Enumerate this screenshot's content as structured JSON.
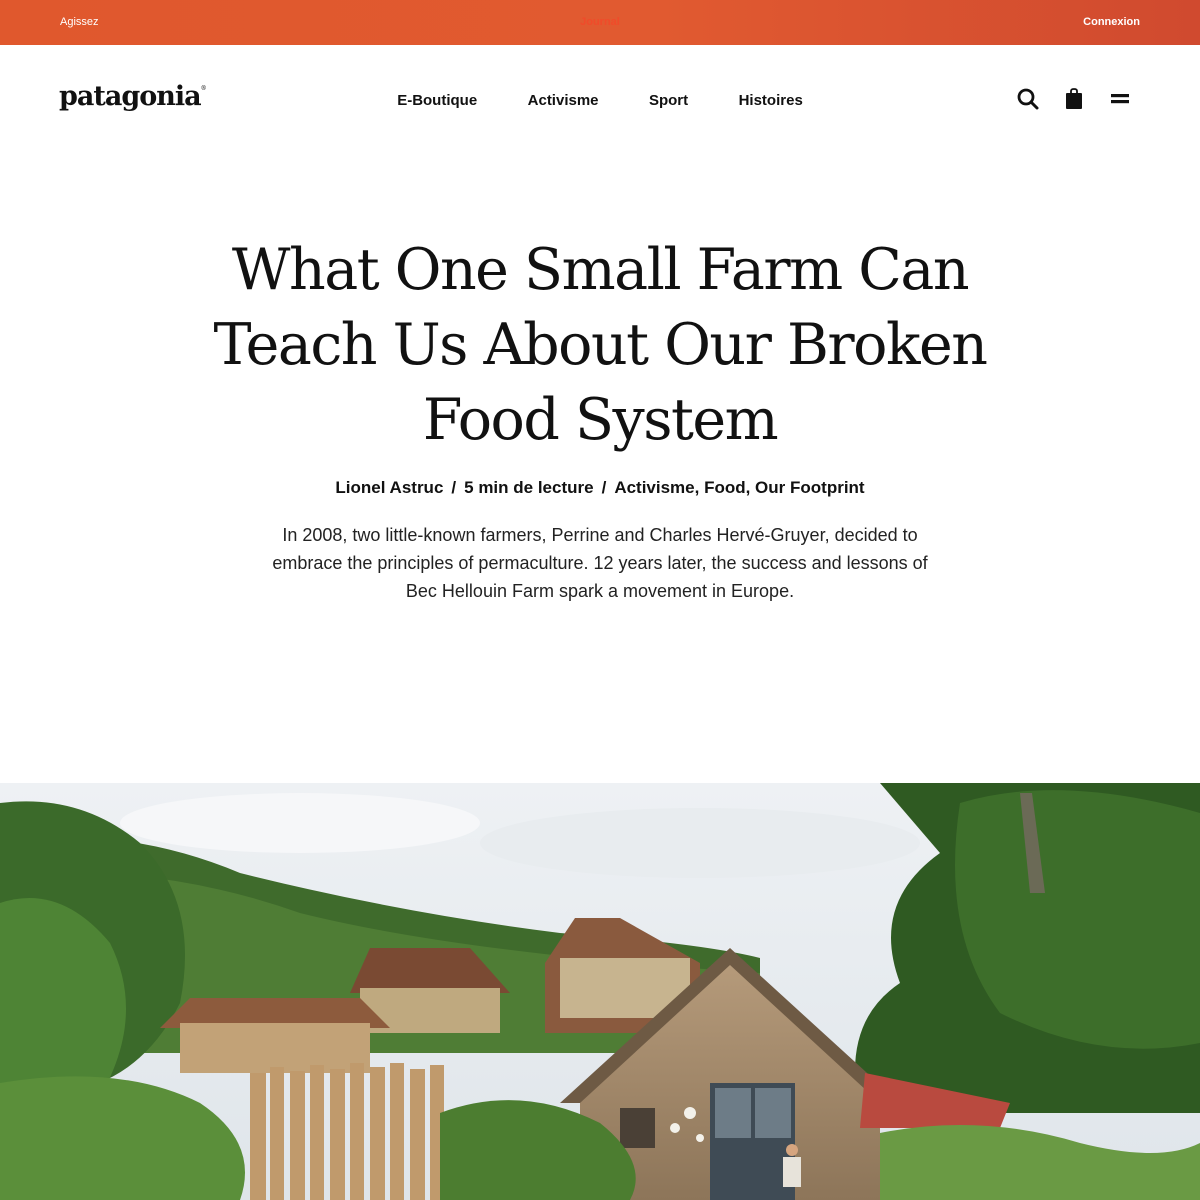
{
  "topbar": {
    "left_link": "Agissez",
    "center_link": "Journal",
    "right_link": "Connexion"
  },
  "header": {
    "logo_text": "patagonia",
    "logo_mark": "®",
    "nav": [
      "E-Boutique",
      "Activisme",
      "Sport",
      "Histoires"
    ],
    "icons": [
      "search-icon",
      "bag-icon",
      "menu-icon"
    ]
  },
  "article": {
    "title": "What One Small Farm Can Teach Us About Our Broken Food System",
    "author": "Lionel Astruc",
    "read_time": "5 min de lecture",
    "tags": "Activisme, Food, Our Footprint",
    "separator": "/",
    "lede": "In 2008, two little-known farmers, Perrine and Charles Hervé-Gruyer, decided to embrace the principles of permaculture. 12 years later, the success and lessons of Bec Hellouin Farm spark a movement in Europe."
  },
  "colors": {
    "topbar": "#e0582d",
    "text": "#111111"
  }
}
